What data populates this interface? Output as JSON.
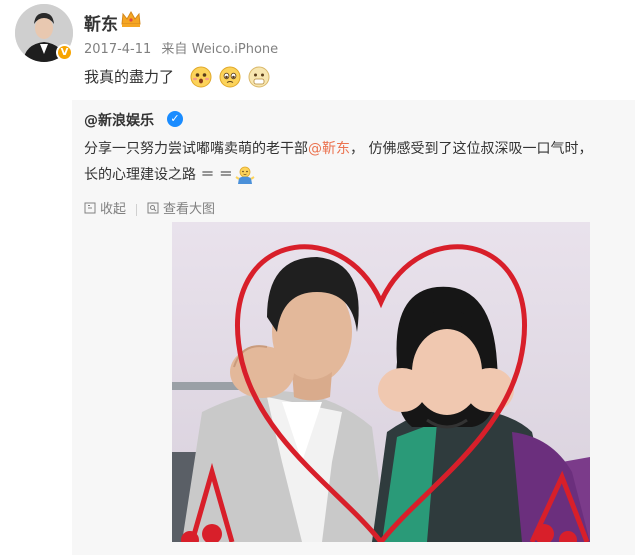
{
  "post": {
    "author": "靳东",
    "date": "2017-4-11",
    "source_prefix": "来自",
    "source": "Weico.iPhone",
    "text": "我真的盡力了",
    "emojis": [
      "shy-face-emoji",
      "cry-face-emoji",
      "surprised-face-emoji"
    ]
  },
  "repost": {
    "author": "@新浪娱乐",
    "text_part1": "分享一只努力尝试嘟嘴卖萌的老干部",
    "mention": "@靳东",
    "text_part2": "， 仿佛感受到了这位叔深吸一口气时，",
    "text_line2": "长的心理建设之路 ＝ ＝",
    "actions": {
      "collapse": "收起",
      "view_large": "查看大图"
    }
  },
  "colors": {
    "mention": "#eb7350",
    "meta": "#808080",
    "repost_bg": "#f7f7f7",
    "verified_orange": "#f7a400",
    "verified_blue": "#1a8cff",
    "heart_frame": "#d81f2a"
  }
}
